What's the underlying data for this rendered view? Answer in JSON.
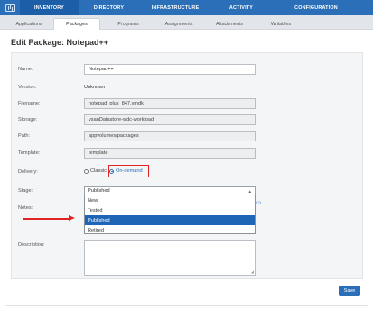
{
  "topnav": {
    "items": [
      "INVENTORY",
      "DIRECTORY",
      "INFRASTRUCTURE",
      "ACTIVITY",
      "CONFIGURATION"
    ],
    "active": "INVENTORY"
  },
  "subtabs": {
    "items": [
      "Applications",
      "Packages",
      "Programs",
      "Assignments",
      "Attachments",
      "Writables"
    ],
    "active": "Packages"
  },
  "page": {
    "title": "Edit Package: Notepad++"
  },
  "form": {
    "name": {
      "label": "Name:",
      "value": "Notepad++"
    },
    "version": {
      "label": "Version:",
      "value": "Unknown"
    },
    "filename": {
      "label": "Filename:",
      "value": "notepad_plus_847.vmdk"
    },
    "storage": {
      "label": "Storage:",
      "value": "vsanDatastore-wdc-workload"
    },
    "path": {
      "label": "Path:",
      "value": "appvolumes/packages"
    },
    "template": {
      "label": "Template:",
      "value": "template"
    },
    "delivery": {
      "label": "Delivery:",
      "options": [
        "Classic",
        "On-demand"
      ],
      "selected": "On-demand"
    },
    "stage": {
      "label": "Stage:",
      "value": "Published",
      "options": [
        "New",
        "Tested",
        "Published",
        "Retired"
      ],
      "highlighted": "Published"
    },
    "notes": {
      "label": "Notes:",
      "hint": "(?)"
    },
    "description": {
      "label": "Description:",
      "value": ""
    }
  },
  "actions": {
    "save_label": "Save"
  },
  "colors": {
    "accent": "#2a6fb7",
    "annotation": "#e02424",
    "selected_option": "#1f65b5"
  }
}
